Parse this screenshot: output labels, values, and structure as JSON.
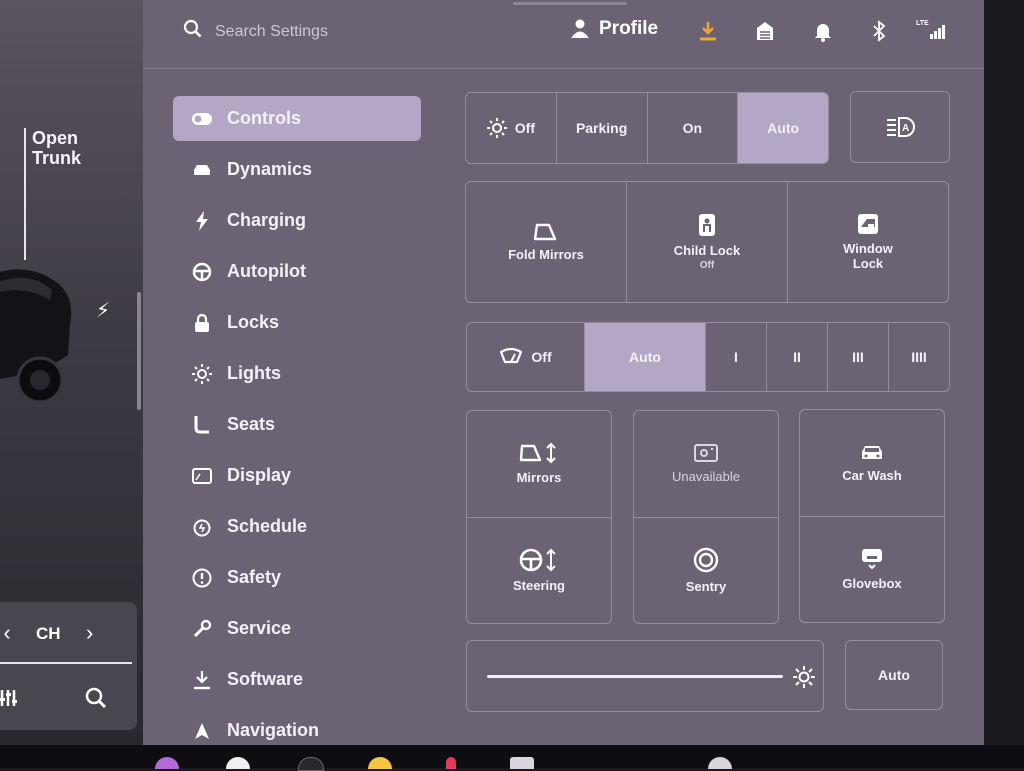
{
  "car_panel": {
    "trunk_label": "Open\nTrunk",
    "media": {
      "channel_label": "CH",
      "prev": "‹",
      "next": "›"
    }
  },
  "top_bar": {
    "search_placeholder": "Search Settings",
    "profile_label": "Profile",
    "icons": [
      "search-icon",
      "download-icon",
      "garage-icon",
      "bell-icon",
      "bluetooth-icon",
      "lte-signal-icon"
    ],
    "accent_color": "#f0a830"
  },
  "nav": {
    "items": [
      {
        "label": "Controls",
        "icon": "toggle-icon",
        "active": true
      },
      {
        "label": "Dynamics",
        "icon": "car-icon"
      },
      {
        "label": "Charging",
        "icon": "bolt-icon"
      },
      {
        "label": "Autopilot",
        "icon": "steering-wheel-icon"
      },
      {
        "label": "Locks",
        "icon": "lock-icon"
      },
      {
        "label": "Lights",
        "icon": "sun-icon"
      },
      {
        "label": "Seats",
        "icon": "seat-icon"
      },
      {
        "label": "Display",
        "icon": "display-icon"
      },
      {
        "label": "Schedule",
        "icon": "alarm-icon"
      },
      {
        "label": "Safety",
        "icon": "alert-icon"
      },
      {
        "label": "Service",
        "icon": "wrench-icon"
      },
      {
        "label": "Software",
        "icon": "download-icon"
      },
      {
        "label": "Navigation",
        "icon": "navigation-icon"
      }
    ]
  },
  "headlights": {
    "options": [
      "Off",
      "Parking",
      "On",
      "Auto"
    ],
    "selected": "Auto"
  },
  "quick_tiles": {
    "fold_mirrors": "Fold Mirrors",
    "child_lock": "Child Lock",
    "child_lock_status": "Off",
    "window_lock": "Window\nLock"
  },
  "wipers": {
    "options": [
      "Off",
      "Auto",
      "I",
      "II",
      "III",
      "IIII"
    ],
    "selected": "Auto"
  },
  "adjust_tiles": {
    "mirrors": "Mirrors",
    "steering": "Steering",
    "unavailable": "Unavailable",
    "sentry": "Sentry",
    "car_wash": "Car Wash",
    "glovebox": "Glovebox"
  },
  "brightness": {
    "level": 0.97,
    "auto_label": "Auto"
  }
}
